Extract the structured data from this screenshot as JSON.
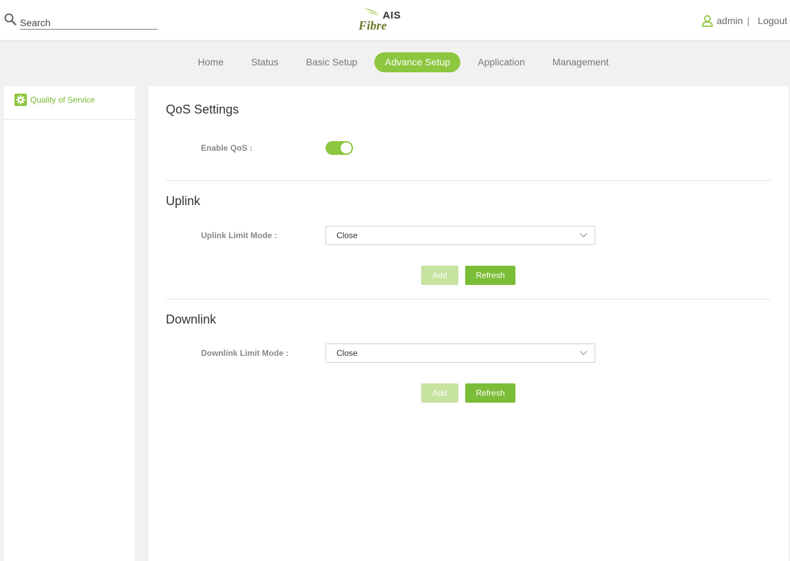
{
  "header": {
    "search_placeholder": "Search",
    "logo_top": "AIS",
    "logo_bottom": "Fibre",
    "username": "admin",
    "separator": "|",
    "logout_label": "Logout"
  },
  "nav": {
    "tabs": [
      {
        "label": "Home"
      },
      {
        "label": "Status"
      },
      {
        "label": "Basic Setup"
      },
      {
        "label": "Advance Setup"
      },
      {
        "label": "Application"
      },
      {
        "label": "Management"
      }
    ],
    "active": "Advance Setup"
  },
  "sidebar": {
    "items": [
      {
        "label": "Quality of Service"
      }
    ]
  },
  "qos": {
    "title": "QoS Settings",
    "enable_label": "Enable QoS :",
    "enabled": true
  },
  "uplink": {
    "title": "Uplink",
    "mode_label": "Uplink Limit Mode :",
    "mode_value": "Close",
    "add_label": "Add",
    "refresh_label": "Refresh"
  },
  "downlink": {
    "title": "Downlink",
    "mode_label": "Downlink Limit Mode :",
    "mode_value": "Close",
    "add_label": "Add",
    "refresh_label": "Refresh"
  },
  "colors": {
    "accent": "#8dc63f",
    "refresh_button": "#7cbd38",
    "add_button_disabled": "#c6e3a0"
  }
}
